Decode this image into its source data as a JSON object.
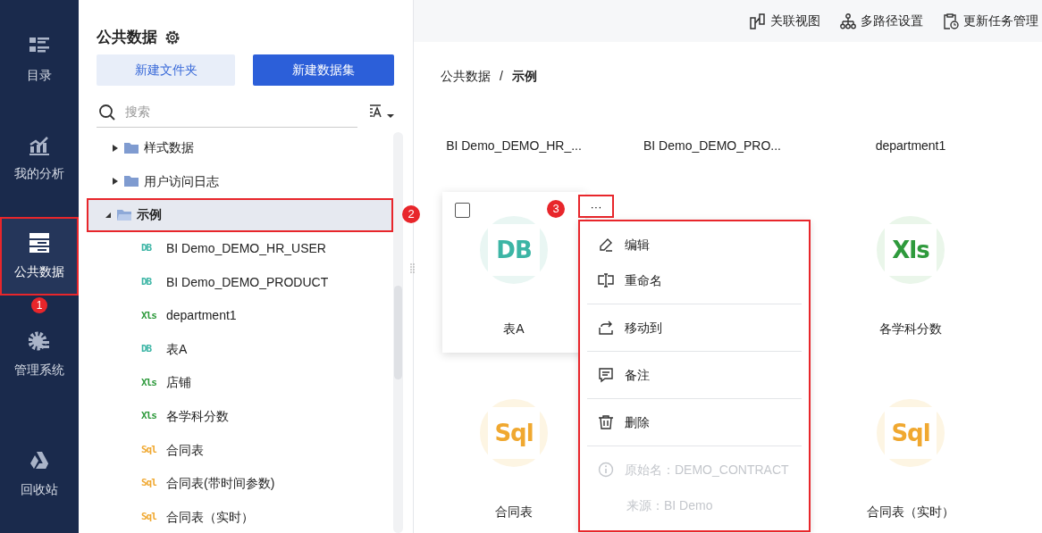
{
  "sidebar": {
    "items": [
      {
        "label": "目录",
        "kind": "catalog",
        "selected": false
      },
      {
        "label": "我的分析",
        "kind": "analysis",
        "selected": false
      },
      {
        "label": "公共数据",
        "kind": "data",
        "selected": true,
        "highlighted": true,
        "callout": "1"
      },
      {
        "label": "管理系统",
        "kind": "manage",
        "selected": false
      },
      {
        "label": "回收站",
        "kind": "recycle",
        "selected": false
      }
    ]
  },
  "panel": {
    "title": "公共数据",
    "buttons": [
      {
        "label": "新建文件夹",
        "kind": "secondary"
      },
      {
        "label": "新建数据集",
        "kind": "primary"
      }
    ],
    "search": {
      "placeholder": "搜索"
    },
    "tree": [
      {
        "label": "样式数据",
        "kind": "folder",
        "expanded": false,
        "selected": false
      },
      {
        "label": "用户访问日志",
        "kind": "folder",
        "expanded": false,
        "selected": false
      },
      {
        "label": "示例",
        "kind": "folder",
        "expanded": true,
        "selected": true,
        "highlighted": true,
        "callout": "2",
        "children": [
          {
            "label": "BI Demo_DEMO_HR_USER",
            "kind": "db",
            "type_label": "DB",
            "selected": false
          },
          {
            "label": "BI Demo_DEMO_PRODUCT",
            "kind": "db",
            "type_label": "DB",
            "selected": false
          },
          {
            "label": "department1",
            "kind": "xls",
            "type_label": "Xls",
            "selected": false
          },
          {
            "label": "表A",
            "kind": "db",
            "type_label": "DB",
            "selected": false
          },
          {
            "label": "店铺",
            "kind": "xls",
            "type_label": "Xls",
            "selected": false
          },
          {
            "label": "各学科分数",
            "kind": "xls",
            "type_label": "Xls",
            "selected": false
          },
          {
            "label": "合同表",
            "kind": "sql",
            "type_label": "Sql",
            "selected": false
          },
          {
            "label": "合同表(带时间参数)",
            "kind": "sql",
            "type_label": "Sql",
            "selected": false
          },
          {
            "label": "合同表（实时）",
            "kind": "sql",
            "type_label": "Sql",
            "selected": false
          }
        ]
      }
    ]
  },
  "toolbar": {
    "items": [
      {
        "label": "关联视图",
        "kind": "relation"
      },
      {
        "label": "多路径设置",
        "kind": "paths"
      },
      {
        "label": "更新任务管理",
        "kind": "tasks"
      }
    ]
  },
  "breadcrumb_separator": "/",
  "breadcrumb": [
    {
      "label": "公共数据",
      "selected": false
    },
    {
      "label": "示例",
      "selected": true
    }
  ],
  "grid": {
    "rows": [
      [
        {
          "label": "BI Demo_DEMO_HR_..."
        },
        {
          "label": "BI Demo_DEMO_PRO..."
        },
        {
          "label": "department1"
        }
      ],
      [
        {
          "label": "表A",
          "kind": "db",
          "type_label": "DB",
          "hovered": true,
          "checked": false,
          "more": {
            "label": "···",
            "highlighted": true,
            "callout": "3"
          }
        },
        null,
        {
          "label": "各学科分数",
          "kind": "xls",
          "type_label": "Xls",
          "hovered": false
        }
      ],
      [
        {
          "label": "合同表",
          "kind": "sql",
          "type_label": "Sql",
          "hovered": false
        },
        null,
        {
          "label": "合同表（实时）",
          "kind": "sql",
          "type_label": "Sql",
          "hovered": false
        }
      ]
    ]
  },
  "context_menu": {
    "highlighted": true,
    "groups": [
      {
        "items": [
          {
            "label": "编辑",
            "kind": "edit",
            "disabled": false
          },
          {
            "label": "重命名",
            "kind": "rename",
            "disabled": false
          }
        ]
      },
      {
        "items": [
          {
            "label": "移动到",
            "kind": "move",
            "disabled": false
          }
        ]
      },
      {
        "items": [
          {
            "label": "备注",
            "kind": "note",
            "disabled": false
          }
        ]
      },
      {
        "items": [
          {
            "label": "删除",
            "kind": "delete",
            "disabled": false
          }
        ]
      },
      {
        "items": [
          {
            "label": "原始名：DEMO_CONTRACT",
            "kind": "info",
            "disabled": true
          },
          {
            "label": "来源：BI Demo",
            "kind": "none",
            "disabled": true
          }
        ]
      }
    ]
  }
}
